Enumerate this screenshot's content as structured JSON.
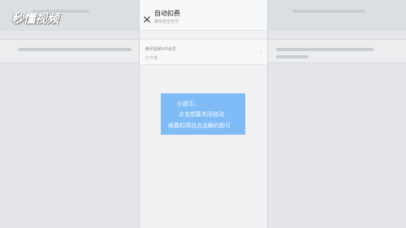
{
  "watermark": {
    "text": "秒懂视频"
  },
  "header": {
    "title": "自动扣费",
    "subtitle": "微信安全支付",
    "close_icon": "close-icon"
  },
  "list": {
    "items": [
      {
        "name": "腾讯视频VIP会员",
        "status": "已开通",
        "arrow_icon": "chevron-right-icon"
      }
    ]
  },
  "tip": {
    "line1": "小提示：",
    "line2": "点击想要关闭自动",
    "line3": "续费的项目点击解约即可"
  },
  "colors": {
    "tip_background": "#7ebbf7",
    "page_background": "#e4e6e9",
    "panel_background": "#f0f1f3"
  }
}
